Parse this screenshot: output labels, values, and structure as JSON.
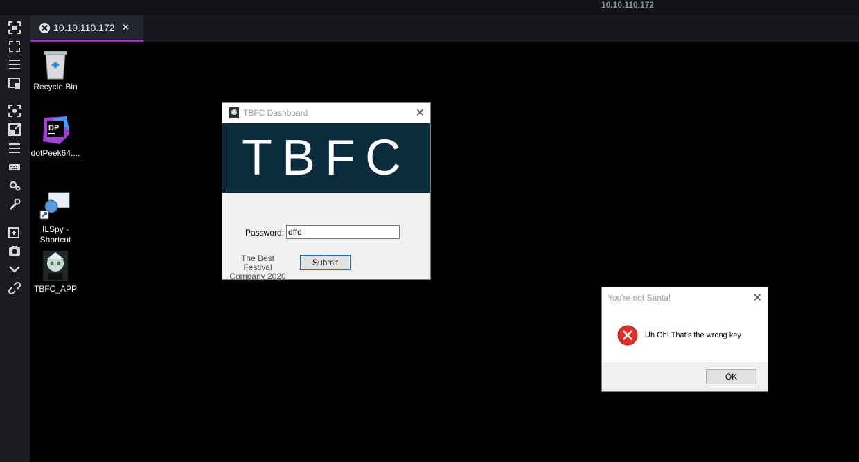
{
  "header": {
    "host": "10.10.110.172"
  },
  "tab": {
    "label": "10.10.110.172",
    "close": "×"
  },
  "sidebar": {
    "icons": [
      "fullscreen-icon",
      "expand-icon",
      "menu-icon",
      "window-icon",
      "capture-icon",
      "resize-icon",
      "list-icon",
      "keyboard-icon",
      "settings-icon",
      "wrench-icon",
      "new-window-icon",
      "camera-icon",
      "chevron-down-icon",
      "link-icon"
    ]
  },
  "desktop": {
    "icons": [
      {
        "name": "recycle-bin",
        "label": "Recycle Bin"
      },
      {
        "name": "dotpeek",
        "label": "dotPeek64...."
      },
      {
        "name": "ilspy-shortcut",
        "label": "ILSpy -\nShortcut"
      },
      {
        "name": "tbfc-app",
        "label": "TBFC_APP"
      }
    ]
  },
  "tbfc_window": {
    "title": "TBFC Dashboard",
    "close": "✕",
    "banner": "TBFC",
    "password_label": "Password:",
    "password_value": "dffd",
    "company": "The Best Festival Company 2020",
    "submit_label": "Submit"
  },
  "error_dialog": {
    "title": "You're not Santa!",
    "close": "✕",
    "message": "Uh Oh! That's the wrong key",
    "ok_label": "OK"
  },
  "colors": {
    "accent": "#b025e0",
    "banner_bg": "#0b2c3c",
    "error_red": "#e0302a"
  }
}
